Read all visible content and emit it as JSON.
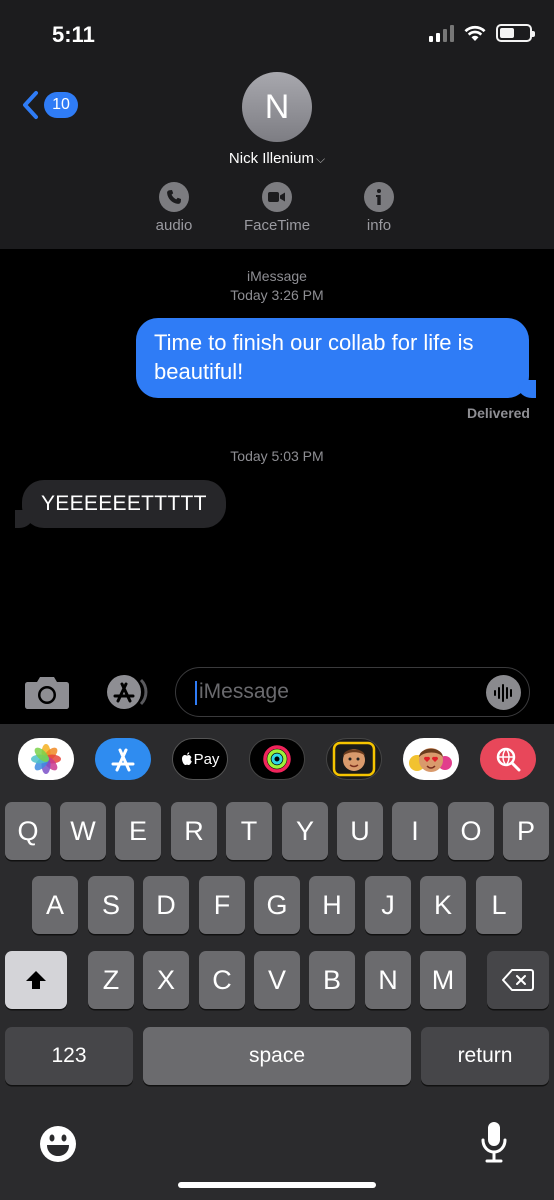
{
  "status_bar": {
    "time": "5:11"
  },
  "nav": {
    "back_count": "10",
    "avatar_initial": "N",
    "contact_name": "Nick Illenium",
    "actions": [
      {
        "id": "audio",
        "label": "audio",
        "icon": "phone-icon"
      },
      {
        "id": "facetime",
        "label": "FaceTime",
        "icon": "video-camera-icon"
      },
      {
        "id": "info",
        "label": "info",
        "icon": "info-icon"
      }
    ]
  },
  "conversation": {
    "service": "iMessage",
    "first_timestamp": "Today 3:26 PM",
    "outgoing_message": "Time to finish our collab for life is beautiful!",
    "status": "Delivered",
    "second_timestamp": "Today 5:03 PM",
    "incoming_message": "YEEEEEETTTTT"
  },
  "compose": {
    "placeholder": "iMessage"
  },
  "app_strip": [
    "photos-app-icon",
    "app-store-app-icon",
    "apple-pay-app-icon",
    "activity-app-icon",
    "memoji-app-icon",
    "memoji-stickers-app-icon",
    "web-search-app-icon"
  ],
  "apple_pay_label": "Pay",
  "keyboard": {
    "row1": [
      "Q",
      "W",
      "E",
      "R",
      "T",
      "Y",
      "U",
      "I",
      "O",
      "P"
    ],
    "row2": [
      "A",
      "S",
      "D",
      "F",
      "G",
      "H",
      "J",
      "K",
      "L"
    ],
    "row3": [
      "Z",
      "X",
      "C",
      "V",
      "B",
      "N",
      "M"
    ],
    "numbers_label": "123",
    "space_label": "space",
    "return_label": "return"
  },
  "colors": {
    "accent": "#2f7cf6",
    "incoming_bubble": "#262629",
    "header_bg": "#1c1c1e",
    "keyboard_bg": "#2b2b2d"
  }
}
